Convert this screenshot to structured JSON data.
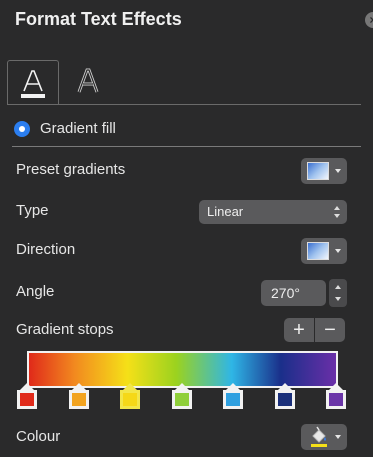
{
  "panel": {
    "title": "Format Text Effects",
    "close_icon": "close-icon"
  },
  "tabs": [
    {
      "name": "text-fill-outline",
      "icon": "text-fill-icon",
      "active": true
    },
    {
      "name": "text-effects",
      "icon": "text-effects-icon",
      "active": false
    }
  ],
  "fill": {
    "option_label": "Gradient fill",
    "selected": true
  },
  "rows": {
    "preset_label": "Preset gradients",
    "type_label": "Type",
    "type_value": "Linear",
    "direction_label": "Direction",
    "angle_label": "Angle",
    "angle_value": "270°",
    "stops_label": "Gradient stops",
    "add_stop": "+",
    "remove_stop": "−",
    "colour_label": "Colour"
  },
  "gradient": {
    "stops": [
      {
        "color": "#e02a1a",
        "selected": false
      },
      {
        "color": "#f2a31f",
        "selected": false
      },
      {
        "color": "#f5d818",
        "selected": true
      },
      {
        "color": "#8fcf3a",
        "selected": false
      },
      {
        "color": "#2fa0e0",
        "selected": false
      },
      {
        "color": "#1a2f7a",
        "selected": false
      },
      {
        "color": "#6a35a8",
        "selected": false
      }
    ]
  },
  "colors": {
    "accent": "#2b7ef0",
    "panel_bg": "#2a2a2b",
    "control_bg": "#5a5a5c"
  }
}
